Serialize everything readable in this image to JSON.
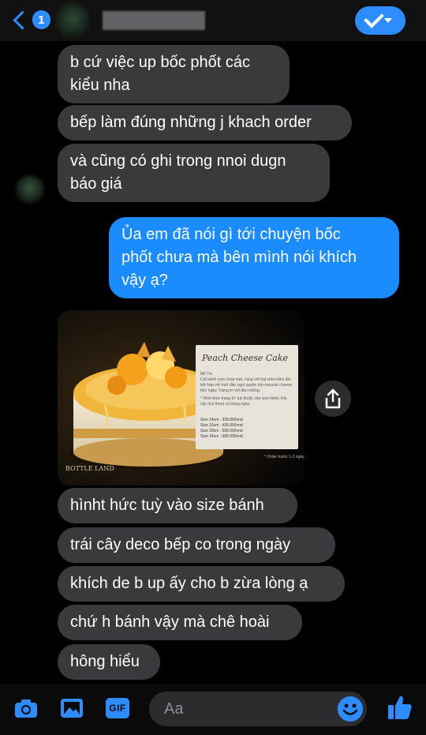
{
  "header": {
    "unread_count": "1"
  },
  "messages": [
    {
      "direction": "in",
      "lines": [
        "b cứ việc up bốc phốt các",
        "kiểu nha"
      ]
    },
    {
      "direction": "in",
      "lines": [
        "bếp làm đúng những j khach order"
      ]
    },
    {
      "direction": "in",
      "lines": [
        "và cũng có ghi trong nnoi dugn",
        "báo giá"
      ]
    },
    {
      "direction": "out",
      "lines": [
        "Ủa em đã nói gì tới chuyện bốc",
        "phốt chưa mà bên mình nói khích",
        "vậy ạ?"
      ]
    },
    {
      "direction": "in",
      "lines": [
        "hìnht hức tuỳ vào size bánh"
      ]
    },
    {
      "direction": "in",
      "lines": [
        "trái cây  deco bếp co trong ngày"
      ]
    },
    {
      "direction": "in",
      "lines": [
        "khích de b up ấy cho b zừa lòng ạ"
      ]
    },
    {
      "direction": "in",
      "lines": [
        "chứ h bánh vậy mà chê hoài"
      ]
    },
    {
      "direction": "in",
      "lines": [
        "hông hiểu"
      ]
    }
  ],
  "image_card": {
    "title": "Peach Cheese Cake",
    "description_label": "Mô Tả:",
    "description": "Cốt bánh cam chua mát, cùng với hạt chia mềm ẩm kết hợp với mứt đào ngọt quyện lớp mousse cheese béo ngậy. Trang trí với đào miếng.",
    "note": "* Hình thức trang trí: tuỳ thuộc vào size bánh, trái cây (tuỳ theo) có trong ngày.",
    "sizes": [
      "Size 14cm : 335.000vnd",
      "Size 16cm : 435.000vnd",
      "Size 20cm : 595.000vnd",
      "Size 24cm : 695.000vnd"
    ],
    "order_note": "* Order trước 1-2 ngày",
    "logo": "BOTTLE LAND"
  },
  "composer": {
    "placeholder": "Aa"
  },
  "colors": {
    "accent": "#1a8cff",
    "incoming_bubble": "#3a3a3c",
    "background": "#000000"
  }
}
